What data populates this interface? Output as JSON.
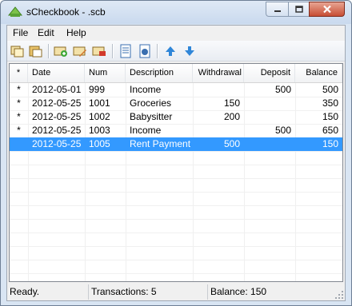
{
  "window": {
    "title": "sCheckbook - .scb"
  },
  "menu": [
    "File",
    "Edit",
    "Help"
  ],
  "toolbar": {
    "buttons": [
      "copy-icon",
      "paste-icon",
      "add-transaction-icon",
      "edit-transaction-icon",
      "delete-transaction-icon",
      "report-icon",
      "balance-icon",
      "move-up-icon",
      "move-down-icon"
    ]
  },
  "table": {
    "columns": [
      "*",
      "Date",
      "Num",
      "Description",
      "Withdrawal",
      "Deposit",
      "Balance"
    ],
    "rows": [
      {
        "flag": "*",
        "date": "2012-05-01",
        "num": "999",
        "desc": "Income",
        "withdrawal": "",
        "deposit": "500",
        "balance": "500",
        "selected": false
      },
      {
        "flag": "*",
        "date": "2012-05-25",
        "num": "1001",
        "desc": "Groceries",
        "withdrawal": "150",
        "deposit": "",
        "balance": "350",
        "selected": false
      },
      {
        "flag": "*",
        "date": "2012-05-25",
        "num": "1002",
        "desc": "Babysitter",
        "withdrawal": "200",
        "deposit": "",
        "balance": "150",
        "selected": false
      },
      {
        "flag": "*",
        "date": "2012-05-25",
        "num": "1003",
        "desc": "Income",
        "withdrawal": "",
        "deposit": "500",
        "balance": "650",
        "selected": false
      },
      {
        "flag": "",
        "date": "2012-05-25",
        "num": "1005",
        "desc": "Rent Payment",
        "withdrawal": "500",
        "deposit": "",
        "balance": "150",
        "selected": true
      }
    ]
  },
  "status": {
    "state": "Ready.",
    "transactions": "Transactions: 5",
    "balance": "Balance: 150"
  },
  "colors": {
    "selection": "#3399ff",
    "titlebar": "#c9d9ee",
    "close": "#c74e34"
  }
}
